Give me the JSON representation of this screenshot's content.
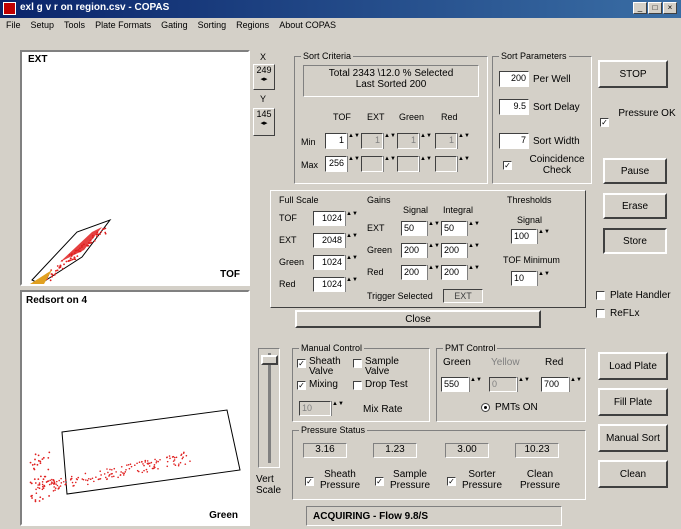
{
  "window": {
    "title": "exl g v r on region.csv - COPAS"
  },
  "menu": [
    "File",
    "Setup",
    "Tools",
    "Plate Formats",
    "Gating",
    "Sorting",
    "Regions",
    "About COPAS"
  ],
  "plots": {
    "top": {
      "ylabel": "EXT",
      "xlabel": "TOF"
    },
    "bottom": {
      "title": "Redsort on 4",
      "xlabel": "Green"
    }
  },
  "coords": {
    "x_label": "X",
    "x_value": "249",
    "y_label": "Y",
    "y_value": "145"
  },
  "sort_criteria": {
    "label": "Sort Criteria",
    "summary_line1": "Total 2343    \\12.0 % Selected",
    "summary_line2": "Last Sorted 200",
    "cols": [
      "TOF",
      "EXT",
      "Green",
      "Red"
    ],
    "min_label": "Min",
    "max_label": "Max",
    "min_values": [
      "1",
      "1",
      "1",
      "1"
    ],
    "max_values": [
      "256",
      "",
      "",
      ""
    ]
  },
  "sort_params": {
    "label": "Sort Parameters",
    "per_well_value": "200",
    "per_well_label": "Per Well",
    "delay_value": "9.5",
    "delay_label": "Sort Delay",
    "width_value": "7",
    "width_label": "Sort Width",
    "coincidence_label": "Coincidence Check"
  },
  "right_buttons": {
    "stop": "STOP",
    "pressure_ok": "Pressure OK",
    "pause": "Pause",
    "erase": "Erase",
    "store": "Store",
    "plate_handler": "Plate Handler",
    "reflx": "ReFLx",
    "load_plate": "Load Plate",
    "fill_plate": "Fill Plate",
    "manual_sort": "Manual Sort",
    "clean": "Clean"
  },
  "full_scale": {
    "label": "Full Scale",
    "rows": [
      {
        "name": "TOF",
        "value": "1024"
      },
      {
        "name": "EXT",
        "value": "2048"
      },
      {
        "name": "Green",
        "value": "1024"
      },
      {
        "name": "Red",
        "value": "1024"
      }
    ]
  },
  "gains": {
    "label": "Gains",
    "col_signal": "Signal",
    "col_integral": "Integral",
    "rows": [
      {
        "name": "EXT",
        "signal": "50",
        "integral": "50"
      },
      {
        "name": "Green",
        "signal": "200",
        "integral": "200"
      },
      {
        "name": "Red",
        "signal": "200",
        "integral": "200"
      }
    ],
    "trigger_label": "Trigger Selected",
    "trigger_value": "EXT"
  },
  "thresholds": {
    "label": "Thresholds",
    "signal_label": "Signal",
    "signal_value": "100",
    "tof_min_label": "TOF Minimum",
    "tof_min_value": "10"
  },
  "close_button": "Close",
  "manual_control": {
    "label": "Manual Control",
    "sheath_valve": "Sheath Valve",
    "sample_valve": "Sample Valve",
    "mixing": "Mixing",
    "drop_test": "Drop Test",
    "mix_rate_value": "10",
    "mix_rate_label": "Mix Rate"
  },
  "pmt_control": {
    "label": "PMT Control",
    "green_label": "Green",
    "yellow_label": "Yellow",
    "red_label": "Red",
    "green_value": "550",
    "yellow_value": "0",
    "red_value": "700",
    "pmts_on": "PMTs ON"
  },
  "pressure_status": {
    "label": "Pressure Status",
    "values": [
      "3.16",
      "1.23",
      "3.00",
      "10.23"
    ],
    "labels": [
      "Sheath Pressure",
      "Sample Pressure",
      "Sorter Pressure",
      "Clean Pressure"
    ]
  },
  "vert_scale": "Vert Scale",
  "status_bar": "ACQUIRING - Flow 9.8/S",
  "colors": {
    "title_start": "#0a246a",
    "title_end": "#3a6ea5",
    "point_red": "#e02020",
    "face": "#d4d0c8"
  }
}
